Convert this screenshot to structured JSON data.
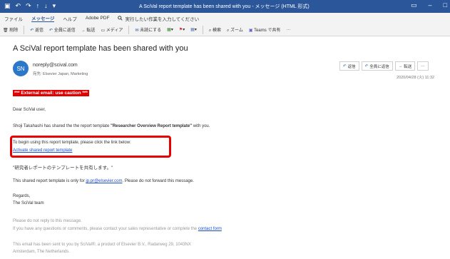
{
  "window": {
    "title": "A SciVal report template has been shared with you  -  メッセージ (HTML 形式)",
    "quick_access": [
      "▣",
      "↶",
      "↷",
      "↑",
      "↓",
      "▾"
    ],
    "controls": [
      "▭",
      "–",
      "□"
    ]
  },
  "menu": {
    "items": [
      "ファイル",
      "メッセージ",
      "ヘルプ",
      "Adobe PDF"
    ],
    "active_index": 1,
    "tell_me_icon": "search-icon",
    "tell_me": "実行したい作業を入力してください"
  },
  "ribbon": {
    "delete": "削除",
    "reply": "返信",
    "reply_all": "全員に返信",
    "forward": "転送",
    "media": "メディア",
    "unread": "未読にする",
    "search": "検索",
    "zoom": "ズーム",
    "teams": "Teams で共有",
    "more": "···"
  },
  "message": {
    "subject": "A SciVal report template has been shared with you",
    "avatar": "SN",
    "sender": "noreply@scival.com",
    "to": "宛先:  Elsevier Japan, Marketing",
    "date": "2020/04/28 (火) 11:32",
    "actions": {
      "reply": "返信",
      "reply_all": "全員に返信",
      "forward": "転送",
      "more": "···"
    }
  },
  "body": {
    "warning": "*** External email: use caution ***",
    "greeting": "Dear SciVal user,",
    "shared_prefix": "Shoji Takahashi has shared the the report template ",
    "template_name": "\"Researcher Overview Report template\"",
    "shared_suffix": " with you.",
    "instruction": "To begin using this report template, please click the link below:",
    "activate_link": "Activate shared report template",
    "japanese_note": "\"研究者レポートのテンプレートを共有します。\"",
    "only_for_prefix": "This shared report template is only for ",
    "only_for_email": "jp.pr@elsevier.com",
    "only_for_suffix": ". Please do not forward this message.",
    "regards": "Regards,",
    "team": "The SciVal team",
    "noreply": "Please do not reply to this message.",
    "questions_prefix": "If you have any questions or comments, please contact your sales representative or complete the ",
    "contact_form": "contact form",
    "footer_line1": "This email has been sent to you by SciVal®, a product of Elsevier B.V., Radarweg 29, 1043NX",
    "footer_line2": "Amsterdam, The Netherlands."
  },
  "colors": {
    "titlebar": "#2b579a",
    "warning": "#e00000",
    "highlight": "#e60000",
    "link": "#1a4dcc"
  }
}
